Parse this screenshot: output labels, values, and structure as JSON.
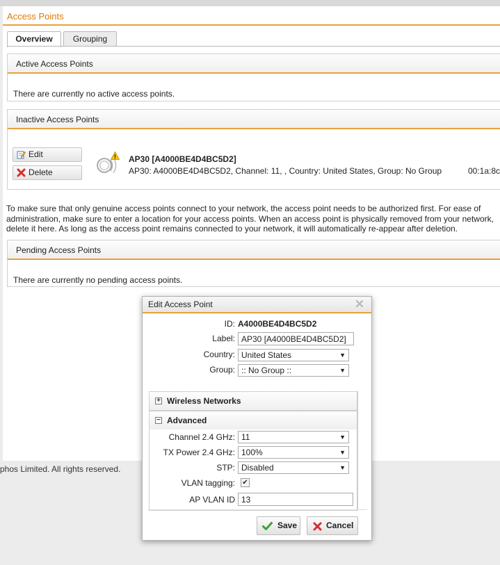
{
  "page": {
    "title": "Access Points",
    "tabs": [
      {
        "label": "Overview",
        "active": true
      },
      {
        "label": "Grouping",
        "active": false
      }
    ],
    "footer_text": "phos Limited. All rights reserved."
  },
  "active_panel": {
    "title": "Active Access Points",
    "empty_text": "There are currently no active access points."
  },
  "inactive_panel": {
    "title": "Inactive Access Points",
    "edit_label": "Edit",
    "delete_label": "Delete",
    "ap_name": "AP30 [A4000BE4D4BC5D2]",
    "ap_detail": "AP30: A4000BE4D4BC5D2, Channel: 11, , Country: United States, Group: No Group",
    "ap_mac": "00:1a:8c"
  },
  "info_text": "To make sure that only genuine access points connect to your network, the access point needs to be authorized first. For ease of administration, make sure to enter a location for your access points. When an access point is physically removed from your network, delete it here. As long as the access point remains connected to your network, it will automatically re-appear after deletion.",
  "pending_panel": {
    "title": "Pending Access Points",
    "empty_text": "There are currently no pending access points."
  },
  "dialog": {
    "title": "Edit Access Point",
    "id_label": "ID:",
    "id_value": "A4000BE4D4BC5D2",
    "label_label": "Label:",
    "label_value": "AP30 [A4000BE4D4BC5D2]",
    "country_label": "Country:",
    "country_value": "United States",
    "group_label": "Group:",
    "group_value": ":: No Group ::",
    "wireless_section": "Wireless Networks",
    "advanced_section": "Advanced",
    "channel_label": "Channel 2.4 GHz:",
    "channel_value": "11",
    "txpower_label": "TX Power 2.4 GHz:",
    "txpower_value": "100%",
    "stp_label": "STP:",
    "stp_value": "Disabled",
    "vlan_tagging_label": "VLAN tagging:",
    "vlan_tagging_checked": true,
    "ap_vlan_label": "AP VLAN ID",
    "ap_vlan_value": "13",
    "save_label": "Save",
    "cancel_label": "Cancel"
  },
  "colors": {
    "accent": "#e8a13c",
    "title": "#e07b00",
    "save_check": "#3aa335",
    "cancel_x": "#d32f2f"
  },
  "icons": [
    "edit-icon",
    "delete-icon",
    "access-point-icon",
    "warning-icon",
    "close-icon",
    "expand-icon",
    "collapse-icon",
    "checkmark-icon",
    "cancel-icon",
    "dropdown-arrow-icon"
  ]
}
